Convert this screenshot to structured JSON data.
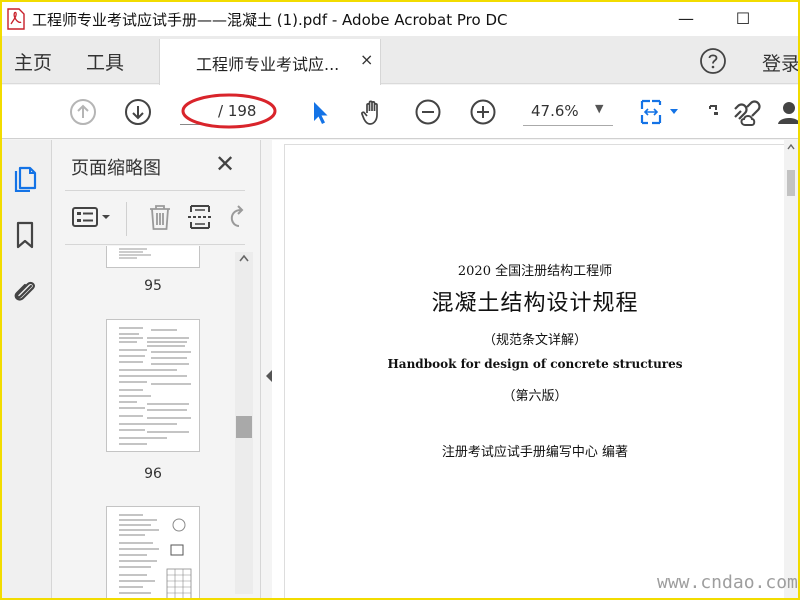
{
  "window": {
    "title": "工程师专业考试应试手册——混凝土 (1).pdf - Adobe Acrobat Pro DC",
    "minimize_glyph": "—",
    "maximize_glyph": "☐",
    "icon": "acrobat-icon"
  },
  "menubar": {
    "home": "主页",
    "tools": "工具",
    "tab_label": "工程师专业考试应...",
    "tab_close": "×",
    "login": "登录"
  },
  "toolbar": {
    "page_current": "",
    "page_total": "/ 198",
    "zoom": "47.6%",
    "zoom_arrow": "▼",
    "highlight_color": "#d9242b",
    "icons": [
      "prev-page-icon",
      "next-page-icon",
      "select-cursor-icon",
      "hand-tool-icon",
      "zoom-out-icon",
      "zoom-in-icon",
      "fit-page-icon",
      "scan-icon",
      "share-link-icon",
      "user-icon"
    ]
  },
  "sidebar": {
    "icons": [
      "pages-icon",
      "bookmark-icon",
      "attachment-icon"
    ],
    "accent": "#1473e6"
  },
  "thumbnails": {
    "title": "页面缩略图",
    "close": "✕",
    "pages": [
      {
        "label": "95"
      },
      {
        "label": "96"
      },
      {
        "label": ""
      }
    ]
  },
  "document": {
    "line1": "2020 全国注册结构工程师",
    "line2": "混凝土结构设计规程",
    "line3": "（规范条文详解）",
    "line4": "Handbook for design of concrete structures",
    "line5": "（第六版）",
    "line6": "注册考试应试手册编写中心  编著"
  },
  "watermark": "www.cndao.com",
  "border_color": "#f2dc00"
}
